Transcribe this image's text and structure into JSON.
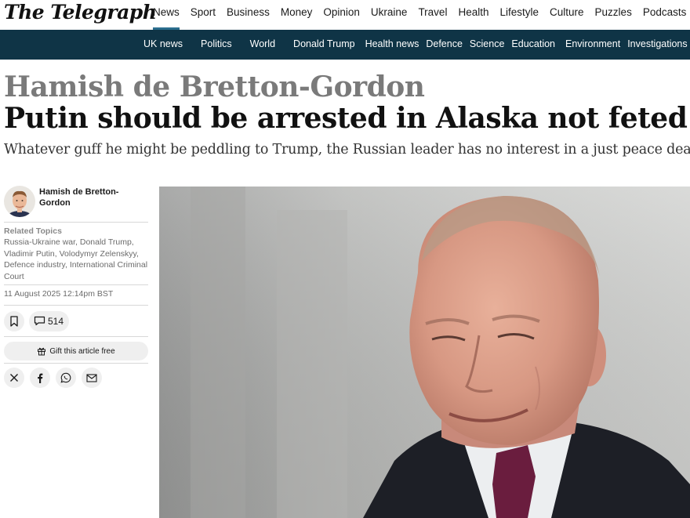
{
  "brand": {
    "logo_text": "The Telegraph"
  },
  "main_nav": [
    {
      "label": "News",
      "active": true
    },
    {
      "label": "Sport"
    },
    {
      "label": "Business"
    },
    {
      "label": "Money"
    },
    {
      "label": "Opinion"
    },
    {
      "label": "Ukraine"
    },
    {
      "label": "Travel"
    },
    {
      "label": "Health"
    },
    {
      "label": "Lifestyle"
    },
    {
      "label": "Culture"
    },
    {
      "label": "Puzzles"
    },
    {
      "label": "Podcasts"
    }
  ],
  "sub_nav": [
    {
      "label": "UK news"
    },
    {
      "label": "Politics"
    },
    {
      "label": "World"
    },
    {
      "label": "Donald Trump"
    },
    {
      "label": "Health news"
    },
    {
      "label": "Defence"
    },
    {
      "label": "Science"
    },
    {
      "label": "Education"
    },
    {
      "label": "Environment"
    },
    {
      "label": "Investigations"
    }
  ],
  "article": {
    "kicker": "Hamish de Bretton-Gordon",
    "headline": "Putin should be arrested in Alaska not feted",
    "standfirst": "Whatever guff he might be peddling to Trump, the Russian leader has no interest in a just peace deal",
    "author": "Hamish de Bretton-Gordon",
    "related_label": "Related Topics",
    "related_topics": "Russia-Ukraine war, Donald Trump, Vladimir Putin, Volodymyr Zelenskyy, Defence industry, International Criminal Court",
    "date": "11 August 2025 12:14pm BST",
    "comment_count": "514",
    "gift_label": "Gift this article free"
  },
  "icons": {
    "bookmark": "bookmark-icon",
    "comment": "comment-icon",
    "gift": "gift-icon",
    "share": [
      "x-icon",
      "facebook-icon",
      "whatsapp-icon",
      "email-icon"
    ]
  },
  "colors": {
    "nav_active": "#2b6e8e",
    "subnav_bg": "#0f3446",
    "kicker": "#7a7a7a"
  }
}
